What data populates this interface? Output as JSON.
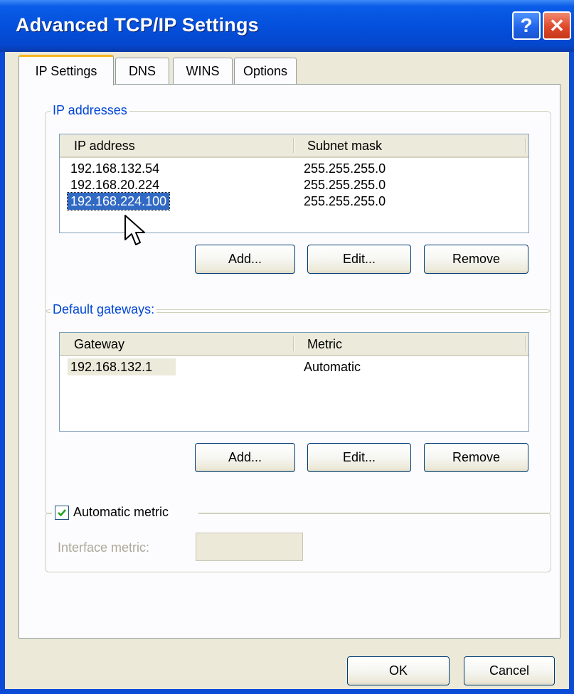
{
  "window": {
    "title": "Advanced TCP/IP Settings",
    "help_label": "?",
    "close_label": "✕"
  },
  "tabs": [
    {
      "label": "IP Settings",
      "active": true
    },
    {
      "label": "DNS",
      "active": false
    },
    {
      "label": "WINS",
      "active": false
    },
    {
      "label": "Options",
      "active": false
    }
  ],
  "ip_addresses": {
    "group_label": "IP addresses",
    "columns": [
      "IP address",
      "Subnet mask"
    ],
    "rows": [
      {
        "ip": "192.168.132.54",
        "mask": "255.255.255.0",
        "selected": false
      },
      {
        "ip": "192.168.20.224",
        "mask": "255.255.255.0",
        "selected": false
      },
      {
        "ip": "192.168.224.100",
        "mask": "255.255.255.0",
        "selected": true
      }
    ],
    "buttons": {
      "add": "Add...",
      "edit": "Edit...",
      "remove": "Remove"
    }
  },
  "gateways": {
    "group_label": "Default gateways:",
    "columns": [
      "Gateway",
      "Metric"
    ],
    "rows": [
      {
        "gateway": "192.168.132.1",
        "metric": "Automatic"
      }
    ],
    "buttons": {
      "add": "Add...",
      "edit": "Edit...",
      "remove": "Remove"
    }
  },
  "metric": {
    "checkbox_label": "Automatic metric",
    "checked": true,
    "interface_label": "Interface metric:",
    "interface_value": ""
  },
  "footer": {
    "ok": "OK",
    "cancel": "Cancel"
  },
  "colors": {
    "title_bar": "#0450dc",
    "selection": "#316ac5",
    "group_label": "#0046d5",
    "active_tab_accent": "#f7b51f"
  }
}
